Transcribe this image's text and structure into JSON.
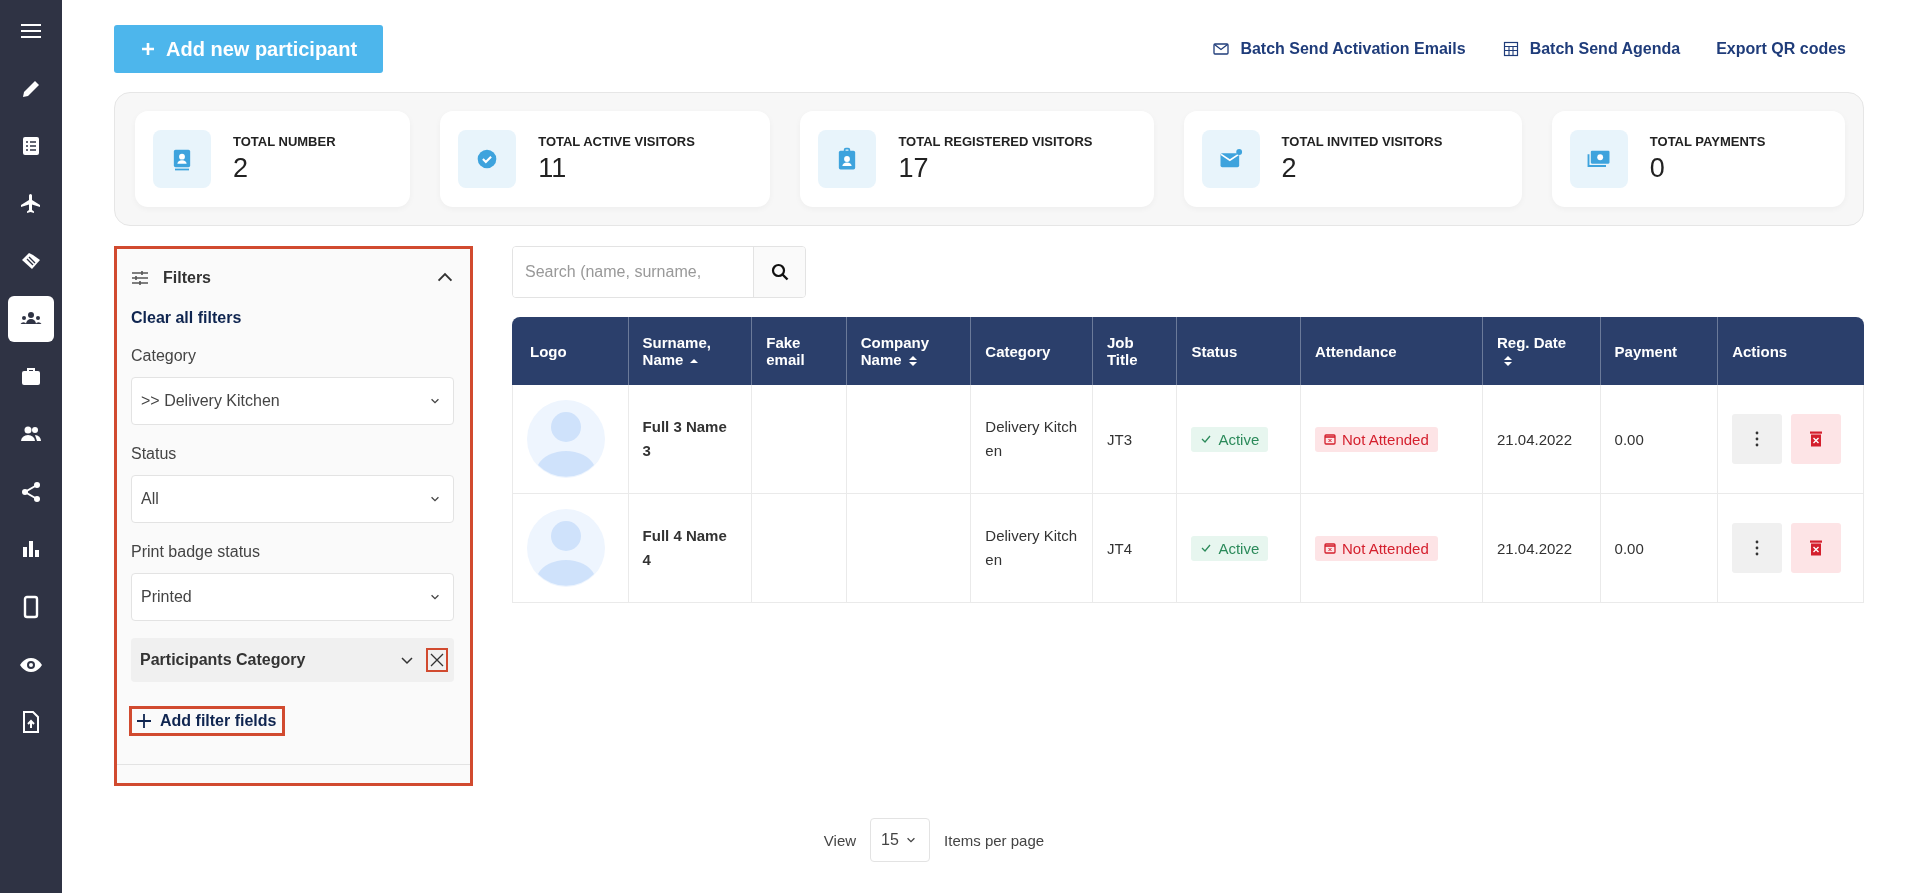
{
  "sidebar": {
    "items": [
      {
        "selected": false
      },
      {
        "selected": false
      },
      {
        "selected": false
      },
      {
        "selected": false
      },
      {
        "selected": true
      },
      {
        "selected": false
      },
      {
        "selected": false
      },
      {
        "selected": false
      },
      {
        "selected": false
      },
      {
        "selected": false
      },
      {
        "selected": false
      },
      {
        "selected": false
      }
    ]
  },
  "add_button": {
    "label": "Add new participant"
  },
  "links": [
    {
      "label": "Batch Send Activation Emails"
    },
    {
      "label": "Batch Send Agenda"
    },
    {
      "label": "Export QR codes"
    }
  ],
  "stats": [
    {
      "label": "TOTAL NUMBER",
      "value": "2"
    },
    {
      "label": "TOTAL ACTIVE VISITORS",
      "value": "11"
    },
    {
      "label": "TOTAL REGISTERED VISITORS",
      "value": "17"
    },
    {
      "label": "TOTAL INVITED VISITORS",
      "value": "2"
    },
    {
      "label": "TOTAL PAYMENTS",
      "value": "0"
    }
  ],
  "filters": {
    "title": "Filters",
    "expanded": true,
    "clear": "Clear all filters",
    "fields": [
      {
        "label": "Category",
        "value": ">> Delivery Kitchen"
      },
      {
        "label": "Status",
        "value": "All"
      },
      {
        "label": "Print badge status",
        "value": "Printed"
      }
    ],
    "extra_field": "Participants Category",
    "add_button": "Add filter fields"
  },
  "search": {
    "placeholder": "Search (name, surname,"
  },
  "table": {
    "columns": [
      {
        "label": "Logo",
        "sortable": false,
        "sorted": false
      },
      {
        "label": "Surname, Name",
        "sortable": true,
        "sorted": true
      },
      {
        "label": "Fake email",
        "sortable": false,
        "sorted": false
      },
      {
        "label": "Company Name",
        "sortable": true,
        "sorted": false
      },
      {
        "label": "Category",
        "sortable": false,
        "sorted": false
      },
      {
        "label": "Job Title",
        "sortable": false,
        "sorted": false
      },
      {
        "label": "Status",
        "sortable": false,
        "sorted": false
      },
      {
        "label": "Attendance",
        "sortable": false,
        "sorted": false
      },
      {
        "label": "Reg. Date",
        "sortable": true,
        "sorted": false
      },
      {
        "label": "Payment",
        "sortable": false,
        "sorted": false
      },
      {
        "label": "Actions",
        "sortable": false,
        "sorted": false
      }
    ],
    "rows": [
      {
        "name": "Full 3 Name 3",
        "category": "Delivery Kitchen",
        "job_title": "JT3",
        "status": "Active",
        "attendance": "Not Attended",
        "reg_date": "21.04.2022",
        "payment": "0.00"
      },
      {
        "name": "Full 4 Name 4",
        "category": "Delivery Kitchen",
        "job_title": "JT4",
        "status": "Active",
        "attendance": "Not Attended",
        "reg_date": "21.04.2022",
        "payment": "0.00"
      }
    ]
  },
  "pagination": {
    "view": "View",
    "per_page": "15",
    "suffix": "Items per page"
  }
}
